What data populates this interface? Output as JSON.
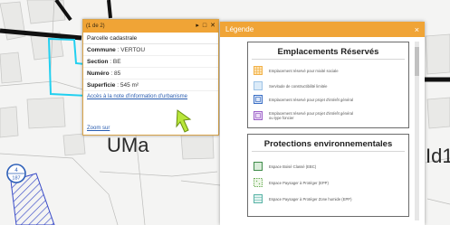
{
  "map": {
    "zone_labels": [
      "UMa",
      "Id1"
    ],
    "badge": {
      "top": "4",
      "bottom": "187"
    }
  },
  "popup": {
    "counter": "(1 de 2)",
    "controls": [
      "▸",
      "□",
      "✕"
    ],
    "title": "Parcelle cadastrale",
    "fields": [
      {
        "label": "Commune",
        "value": "VERTOU"
      },
      {
        "label": "Section",
        "value": "BE"
      },
      {
        "label": "Numéro",
        "value": "85"
      },
      {
        "label": "Superficie",
        "value": "545 m²"
      }
    ],
    "link_text": "Accès à la note d'information d'urbanisme",
    "zoom_text": "Zoom sur"
  },
  "legend": {
    "title": "Légende",
    "close": "×",
    "sections": [
      {
        "title": "Emplacements Réservés",
        "items": [
          {
            "text": "Emplacement réservé pour mixité sociale",
            "color": "#f2b24a",
            "pattern": "grid"
          },
          {
            "text": "Servitude de constructibilité limitée",
            "color": "#9ec3e6",
            "pattern": "plain"
          },
          {
            "text": "Emplacement réservé pour projet d'intérêt général",
            "color": "#3b6fc4",
            "pattern": "box"
          },
          {
            "text": "Emplacement réservé pour projet d'intérêt général ou type foncier",
            "color": "#9b5fc7",
            "pattern": "box"
          }
        ]
      },
      {
        "title": "Protections environnementales",
        "items": [
          {
            "text": "Espace Boisé Classé (EBC)",
            "color": "#3f8c4a",
            "pattern": "plain"
          },
          {
            "text": "Espace Paysager à Protéger (EPP)",
            "color": "#6fb05b",
            "pattern": "dots"
          },
          {
            "text": "Espace Paysager à Protéger Zone humide (EPP)",
            "color": "#59b3a6",
            "pattern": "lines"
          }
        ]
      }
    ]
  }
}
